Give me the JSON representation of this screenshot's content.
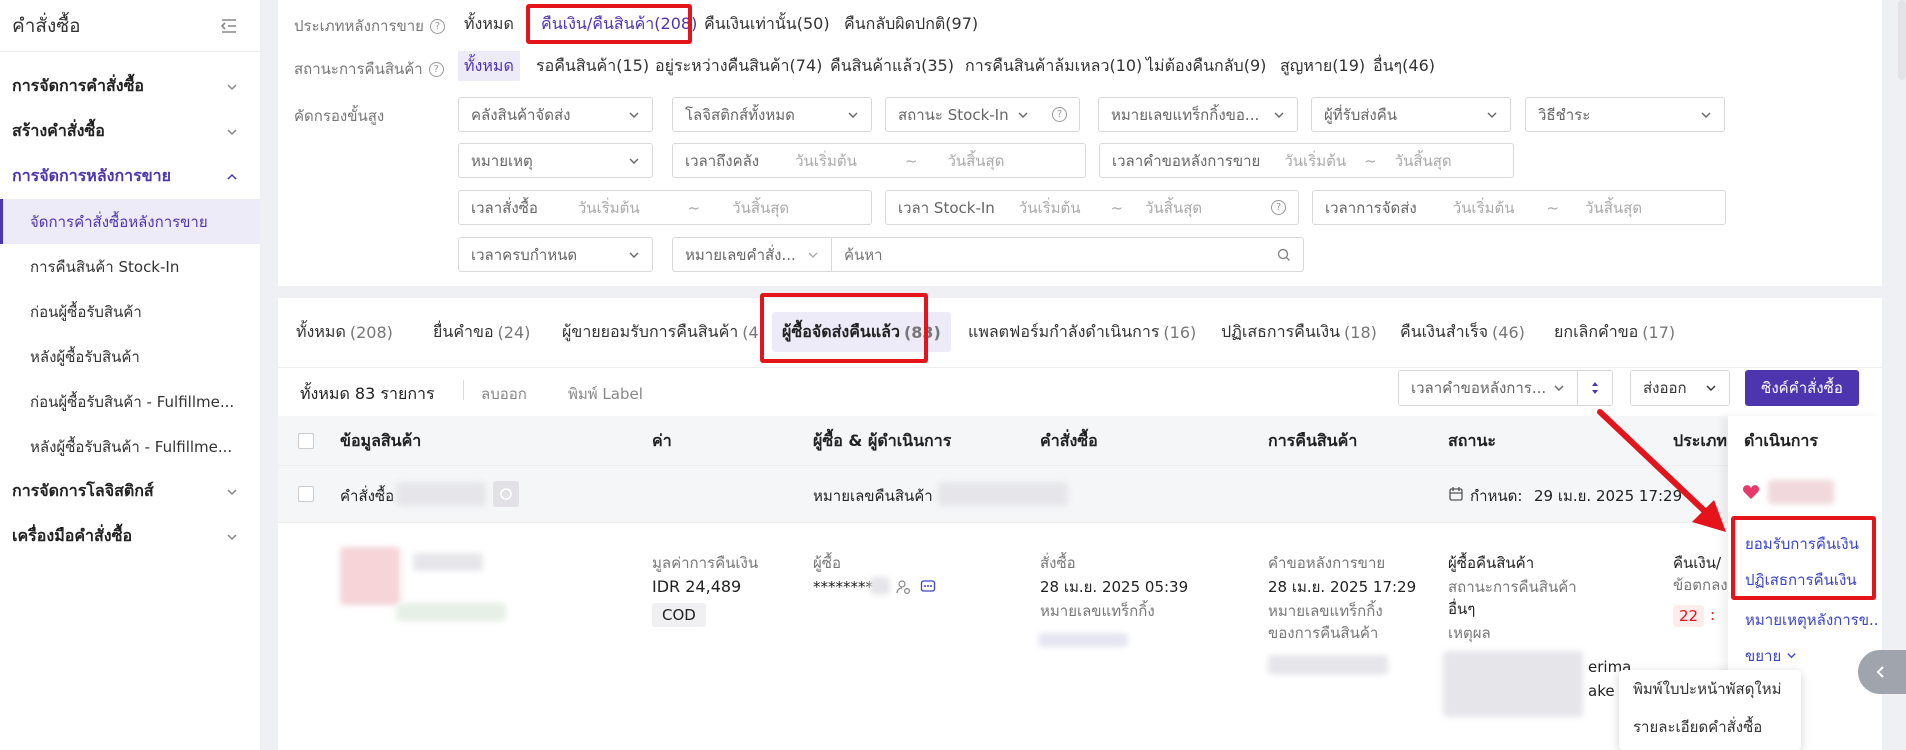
{
  "sidebar": {
    "title": "คำสั่งซื้อ",
    "groups": [
      {
        "label": "การจัดการคำสั่งซื้อ"
      },
      {
        "label": "สร้างคำสั่งซื้อ"
      },
      {
        "label": "การจัดการหลังการขาย"
      },
      {
        "label": "การจัดการโลจิสติกส์"
      },
      {
        "label": "เครื่องมือคำสั่งซื้อ"
      }
    ],
    "items": [
      {
        "label": "จัดการคำสั่งซื้อหลังการขาย"
      },
      {
        "label": "การคืนสินค้า Stock-In"
      },
      {
        "label": "ก่อนผู้ซื้อรับสินค้า"
      },
      {
        "label": "หลังผู้ซื้อรับสินค้า"
      },
      {
        "label": "ก่อนผู้ซื้อรับสินค้า - Fulfillme..."
      },
      {
        "label": "หลังผู้ซื้อรับสินค้า - Fulfillme..."
      }
    ]
  },
  "filters": {
    "type_label": "ประเภทหลังการขาย",
    "type_chips": [
      {
        "label": "ทั้งหมด"
      },
      {
        "label": "คืนเงิน/คืนสินค้า(208)"
      },
      {
        "label": "คืนเงินเท่านั้น(50)"
      },
      {
        "label": "คืนกลับผิดปกติ(97)"
      }
    ],
    "status_label": "สถานะการคืนสินค้า",
    "status_chips": [
      {
        "label": "ทั้งหมด"
      },
      {
        "label": "รอคืนสินค้า(15)"
      },
      {
        "label": "อยู่ระหว่างคืนสินค้า(74)"
      },
      {
        "label": "คืนสินค้าแล้ว(35)"
      },
      {
        "label": "การคืนสินค้าล้มเหลว(10)"
      },
      {
        "label": "ไม่ต้องคืนกลับ(9)"
      },
      {
        "label": "สูญหาย(19)"
      },
      {
        "label": "อื่นๆ(46)"
      }
    ],
    "advanced_label": "คัดกรองขั้นสูง",
    "warehouse": "คลังสินค้าจัดส่ง",
    "logistics": "โลจิสติกส์ทั้งหมด",
    "stockin_status": "สถานะ Stock-In",
    "tracking": "หมายเลขแทร็กกิ้งขอ...",
    "return_carrier": "ผู้ที่รับส่งคืน",
    "payment": "วิธีชำระ",
    "reason": "หมายเหตุ",
    "warehouse_time": "เวลาถึงคลัง",
    "request_time": "เวลาคำขอหลังการขาย",
    "order_time": "เวลาสั่งซื้อ",
    "stockin_time": "เวลา Stock-In",
    "ship_time": "เวลาการจัดส่ง",
    "due_time": "เวลาครบกำหนด",
    "order_no": "หมายเลขคำสั่ง...",
    "start_ph": "วันเริ่มต้น",
    "end_ph": "วันสิ้นสุด",
    "tilde": "~",
    "search_ph": "ค้นหา"
  },
  "tabs": [
    {
      "label": "ทั้งหมด",
      "count": "(208)"
    },
    {
      "label": "ยื่นคำขอ",
      "count": "(24)"
    },
    {
      "label": "ผู้ขายยอมรับการคืนสินค้า",
      "count": "(4)"
    },
    {
      "label": "ผู้ซื้อจัดส่งคืนแล้ว",
      "count": "(83)"
    },
    {
      "label": "แพลตฟอร์มกำลังดำเนินการ",
      "count": "(16)"
    },
    {
      "label": "ปฏิเสธการคืนเงิน",
      "count": "(18)"
    },
    {
      "label": "คืนเงินสำเร็จ",
      "count": "(46)"
    },
    {
      "label": "ยกเลิกคำขอ",
      "count": "(17)"
    }
  ],
  "toolbar": {
    "total": "ทั้งหมด 83 รายการ",
    "delete": "ลบออก",
    "print_label": "พิมพ์ Label",
    "sort": "เวลาคำขอหลังการ...",
    "export": "ส่งออก",
    "sync": "ซิงค์คำสั่งซื้อ"
  },
  "columns": [
    "ข้อมูลสินค้า",
    "ค่า",
    "ผู้ซื้อ & ผู้ดำเนินการ",
    "คำสั่งซื้อ",
    "การคืนสินค้า",
    "สถานะ",
    "ประเภท",
    "ดำเนินการ"
  ],
  "group_row": {
    "order_label": "คำสั่งซื้อ",
    "return_label": "หมายเลขคืนสินค้า",
    "due_label": "กำหนด:",
    "due_value": "29 เม.ย. 2025 17:29"
  },
  "row": {
    "refund_label": "มูลค่าการคืนเงิน",
    "refund_value": "IDR 24,489",
    "payment_badge": "COD",
    "buyer_label": "ผู้ซื้อ",
    "buyer_value": "********",
    "order_label": "สั่งซื้อ",
    "order_time": "28 เม.ย. 2025 05:39",
    "tracking_label": "หมายเลขแทร็กกิ้ง",
    "request_label": "คำขอหลังการขาย",
    "request_time": "28 เม.ย. 2025 17:29",
    "return_tracking_1": "หมายเลขแทร็กกิ้ง",
    "return_tracking_2": "ของการคืนสินค้า",
    "status_title": "ผู้ซื้อคืนสินค้า",
    "status_sub": "สถานะการคืนสินค้า",
    "status_value": "อื่นๆ",
    "reason_label": "เหตุผล",
    "reason_frag_1": "erima",
    "reason_frag_2": "ake",
    "type_value": "คืนเงิน/",
    "type_sub": "ข้อตกลง",
    "countdown": "22",
    "countdown_sep": ":"
  },
  "actions": {
    "accept": "ยอมรับการคืนเงิน",
    "reject": "ปฏิเสธการคืนเงิน",
    "note": "หมายเหตุหลังการข...",
    "expand": "ขยาย"
  },
  "popup": {
    "print_new": "พิมพ์ใบปะหน้าพัสดุใหม่",
    "details": "รายละเอียดคำสั่งซื้อ"
  },
  "colors": {
    "brand": "#4e35b0",
    "highlight": "#e5141b",
    "link": "#3a44c9"
  }
}
